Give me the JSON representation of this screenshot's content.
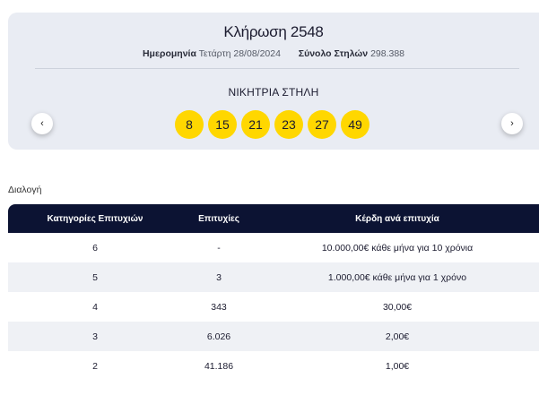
{
  "draw": {
    "title": "Κλήρωση 2548",
    "date_label": "Ημερομηνία",
    "date_value": "Τετάρτη 28/08/2024",
    "total_label": "Σύνολο Στηλών",
    "total_value": "298.388",
    "winning_label": "ΝΙΚΗΤΡΙΑ ΣΤΗΛΗ",
    "numbers": [
      "8",
      "15",
      "21",
      "23",
      "27",
      "49"
    ],
    "prev_icon": "‹",
    "next_icon": "›"
  },
  "section_label": "Διαλογή",
  "results": {
    "headers": [
      "Κατηγορίες Επιτυχιών",
      "Επιτυχίες",
      "Κέρδη ανά επιτυχία"
    ],
    "rows": [
      [
        "6",
        "-",
        "10.000,00€ κάθε μήνα για 10 χρόνια"
      ],
      [
        "5",
        "3",
        "1.000,00€ κάθε μήνα για 1 χρόνο"
      ],
      [
        "4",
        "343",
        "30,00€"
      ],
      [
        "3",
        "6.026",
        "2,00€"
      ],
      [
        "2",
        "41.186",
        "1,00€"
      ]
    ]
  },
  "colors": {
    "ball": "#ffd700",
    "header_bg": "#0c1333",
    "panel_bg": "#e9ecf3"
  }
}
